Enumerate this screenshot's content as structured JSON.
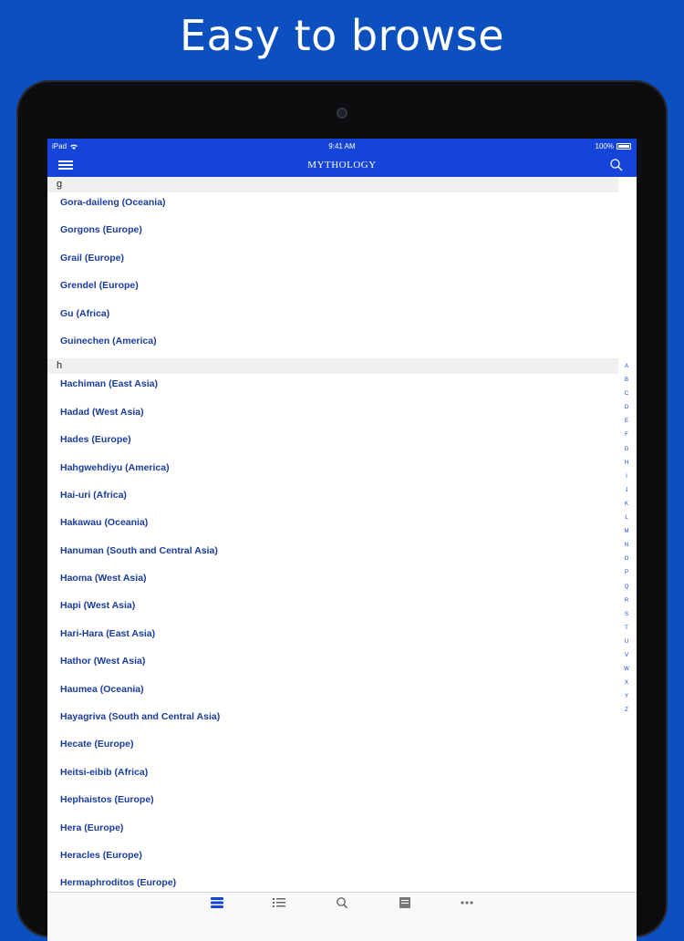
{
  "banner": {
    "title": "Easy to browse"
  },
  "status": {
    "carrier": "iPad",
    "time": "9:41 AM",
    "battery": "100%"
  },
  "nav": {
    "title": "MYTHOLOGY"
  },
  "sections": [
    {
      "letter": "g",
      "items": [
        "Gora-daileng (Oceania)",
        "Gorgons (Europe)",
        "Grail (Europe)",
        "Grendel (Europe)",
        "Gu (Africa)",
        "Guinechen (America)"
      ]
    },
    {
      "letter": "h",
      "items": [
        "Hachiman (East Asia)",
        "Hadad (West Asia)",
        "Hades (Europe)",
        "Hahgwehdiyu (America)",
        "Hai-uri (Africa)",
        "Hakawau (Oceania)",
        "Hanuman (South and Central Asia)",
        "Haoma (West Asia)",
        "Hapi (West Asia)",
        "Hari-Hara (East Asia)",
        "Hathor (West Asia)",
        "Haumea (Oceania)",
        "Hayagriva (South and Central Asia)",
        "Hecate (Europe)",
        "Heitsi-eibib (Africa)",
        "Hephaistos (Europe)",
        "Hera (Europe)",
        "Heracles (Europe)",
        "Hermaphroditos (Europe)"
      ]
    }
  ],
  "index_letters": [
    "A",
    "B",
    "C",
    "D",
    "E",
    "F",
    "G",
    "H",
    "I",
    "J",
    "K",
    "L",
    "M",
    "N",
    "O",
    "P",
    "Q",
    "R",
    "S",
    "T",
    "U",
    "V",
    "W",
    "X",
    "Y",
    "Z"
  ],
  "tabs": [
    {
      "icon": "stack-icon",
      "active": true
    },
    {
      "icon": "list-icon",
      "active": false
    },
    {
      "icon": "search-icon",
      "active": false
    },
    {
      "icon": "notes-icon",
      "active": false
    },
    {
      "icon": "more-icon",
      "active": false
    }
  ],
  "colors": {
    "accent": "#1544d8",
    "link": "#1a3c9c",
    "background": "#0c4fbf"
  }
}
